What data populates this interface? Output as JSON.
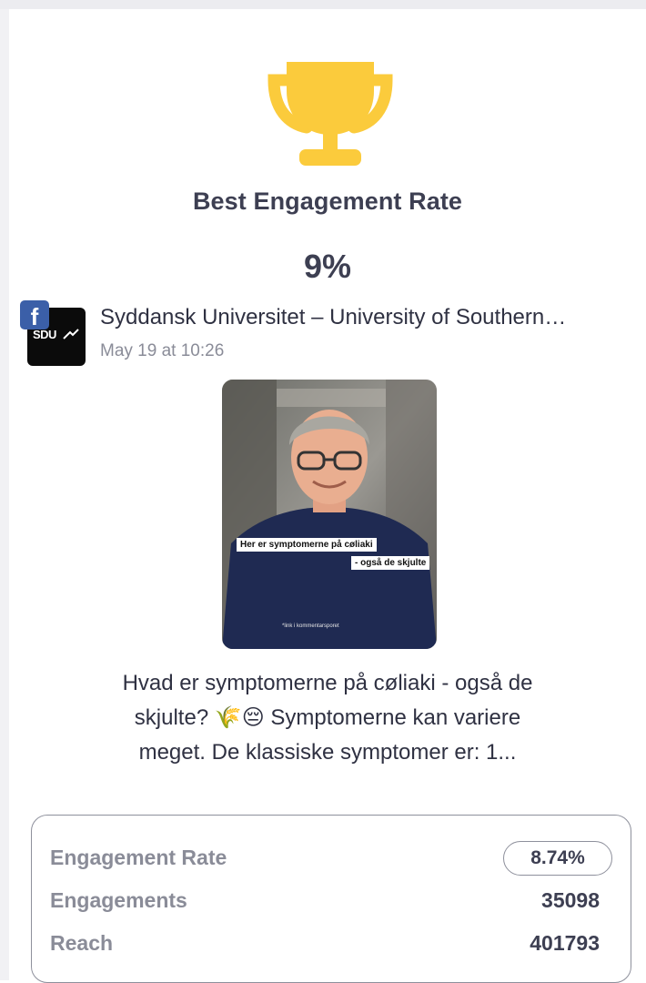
{
  "header": {
    "title": "Best Engagement Rate",
    "value": "9%",
    "trophy_color": "#fbcb3c"
  },
  "post": {
    "network_icon": "facebook-icon",
    "avatar_text": "SDU",
    "page_name": "Syddansk Universitet – University of Southern…",
    "date": "May 19 at 10:26",
    "image": {
      "caption_line1": "Her er symptomerne på cøliaki",
      "caption_line2": "- også de skjulte",
      "footer_text": "*link i kommentarsporet"
    },
    "text": "Hvad er symptomerne på cøliaki - også de skjulte? 🌾😔 Symptomerne kan variere meget. De klassiske symptomer er: 1..."
  },
  "stats": {
    "engagement_rate_label": "Engagement Rate",
    "engagement_rate_value": "8.74%",
    "engagements_label": "Engagements",
    "engagements_value": "35098",
    "reach_label": "Reach",
    "reach_value": "401793"
  },
  "colors": {
    "facebook": "#3b5fa8",
    "text_primary": "#3d3f52",
    "text_muted": "#8a8c98"
  }
}
